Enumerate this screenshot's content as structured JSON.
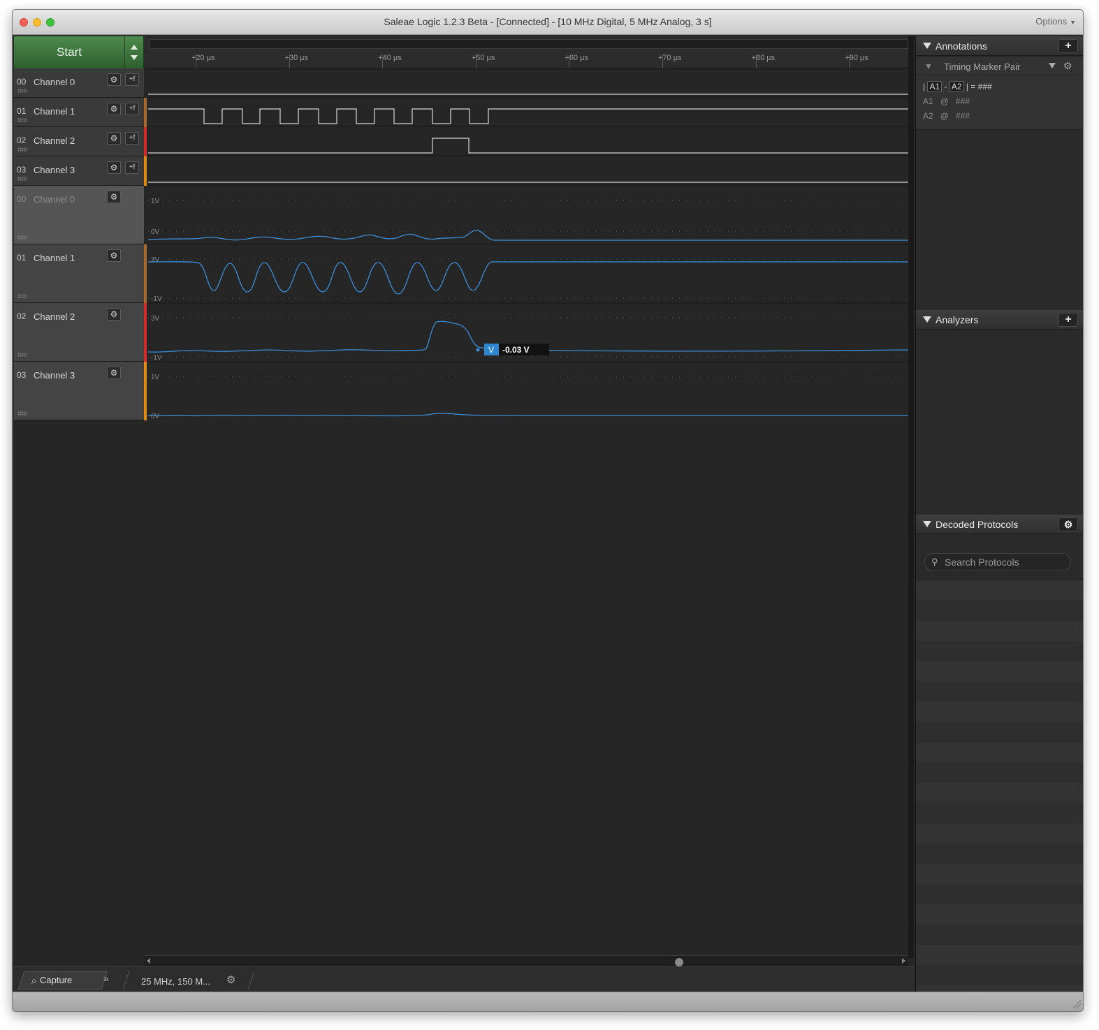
{
  "window": {
    "title": "Saleae Logic 1.2.3 Beta - [Connected] - [10 MHz Digital, 5 MHz Analog, 3 s]",
    "options_label": "Options"
  },
  "toolbar": {
    "start_label": "Start"
  },
  "ruler": {
    "ticks": [
      "+20 µs",
      "+30 µs",
      "+40 µs",
      "+50 µs",
      "+60 µs",
      "+70 µs",
      "+80 µs",
      "+90 µs"
    ]
  },
  "digital_channels": [
    {
      "num": "00",
      "name": "Channel 0",
      "color": "#c97a1a"
    },
    {
      "num": "01",
      "name": "Channel 1",
      "color": "#a86a2c"
    },
    {
      "num": "02",
      "name": "Channel 2",
      "color": "#d12b2b"
    },
    {
      "num": "03",
      "name": "Channel 3",
      "color": "#e08a14"
    }
  ],
  "analog_channels": [
    {
      "num": "00",
      "name": "Channel 0",
      "color": "#7a7a7a",
      "top_label": "1V",
      "bottom_label": "0V"
    },
    {
      "num": "01",
      "name": "Channel 1",
      "color": "#a86a2c",
      "top_label": "3V",
      "bottom_label": "-1V"
    },
    {
      "num": "02",
      "name": "Channel 2",
      "color": "#d12b2b",
      "top_label": "3V",
      "bottom_label": "-1V"
    },
    {
      "num": "03",
      "name": "Channel 3",
      "color": "#e08a14",
      "top_label": "1V",
      "bottom_label": "0V"
    }
  ],
  "measurement": {
    "tag": "V",
    "value": "-0.03 V"
  },
  "bottom_bar": {
    "capture_label": "Capture",
    "rate_label": "25 MHz, 150 M..."
  },
  "sidebar": {
    "annotations": {
      "title": "Annotations",
      "timing_marker": "Timing Marker Pair",
      "delta_left": "|",
      "a1_tag": "A1",
      "dash": "-",
      "a2_tag": "A2",
      "delta_eq": "| = ###",
      "a1_label": "A1",
      "a1_at": "@",
      "a1_value": "###",
      "a2_label": "A2",
      "a2_at": "@",
      "a2_value": "###"
    },
    "analyzers": {
      "title": "Analyzers"
    },
    "decoded": {
      "title": "Decoded Protocols",
      "search_placeholder": "Search Protocols"
    }
  },
  "colors": {
    "signal_line": "#3c8ed8",
    "start_button": "#3f7a3f",
    "background": "#262626"
  }
}
